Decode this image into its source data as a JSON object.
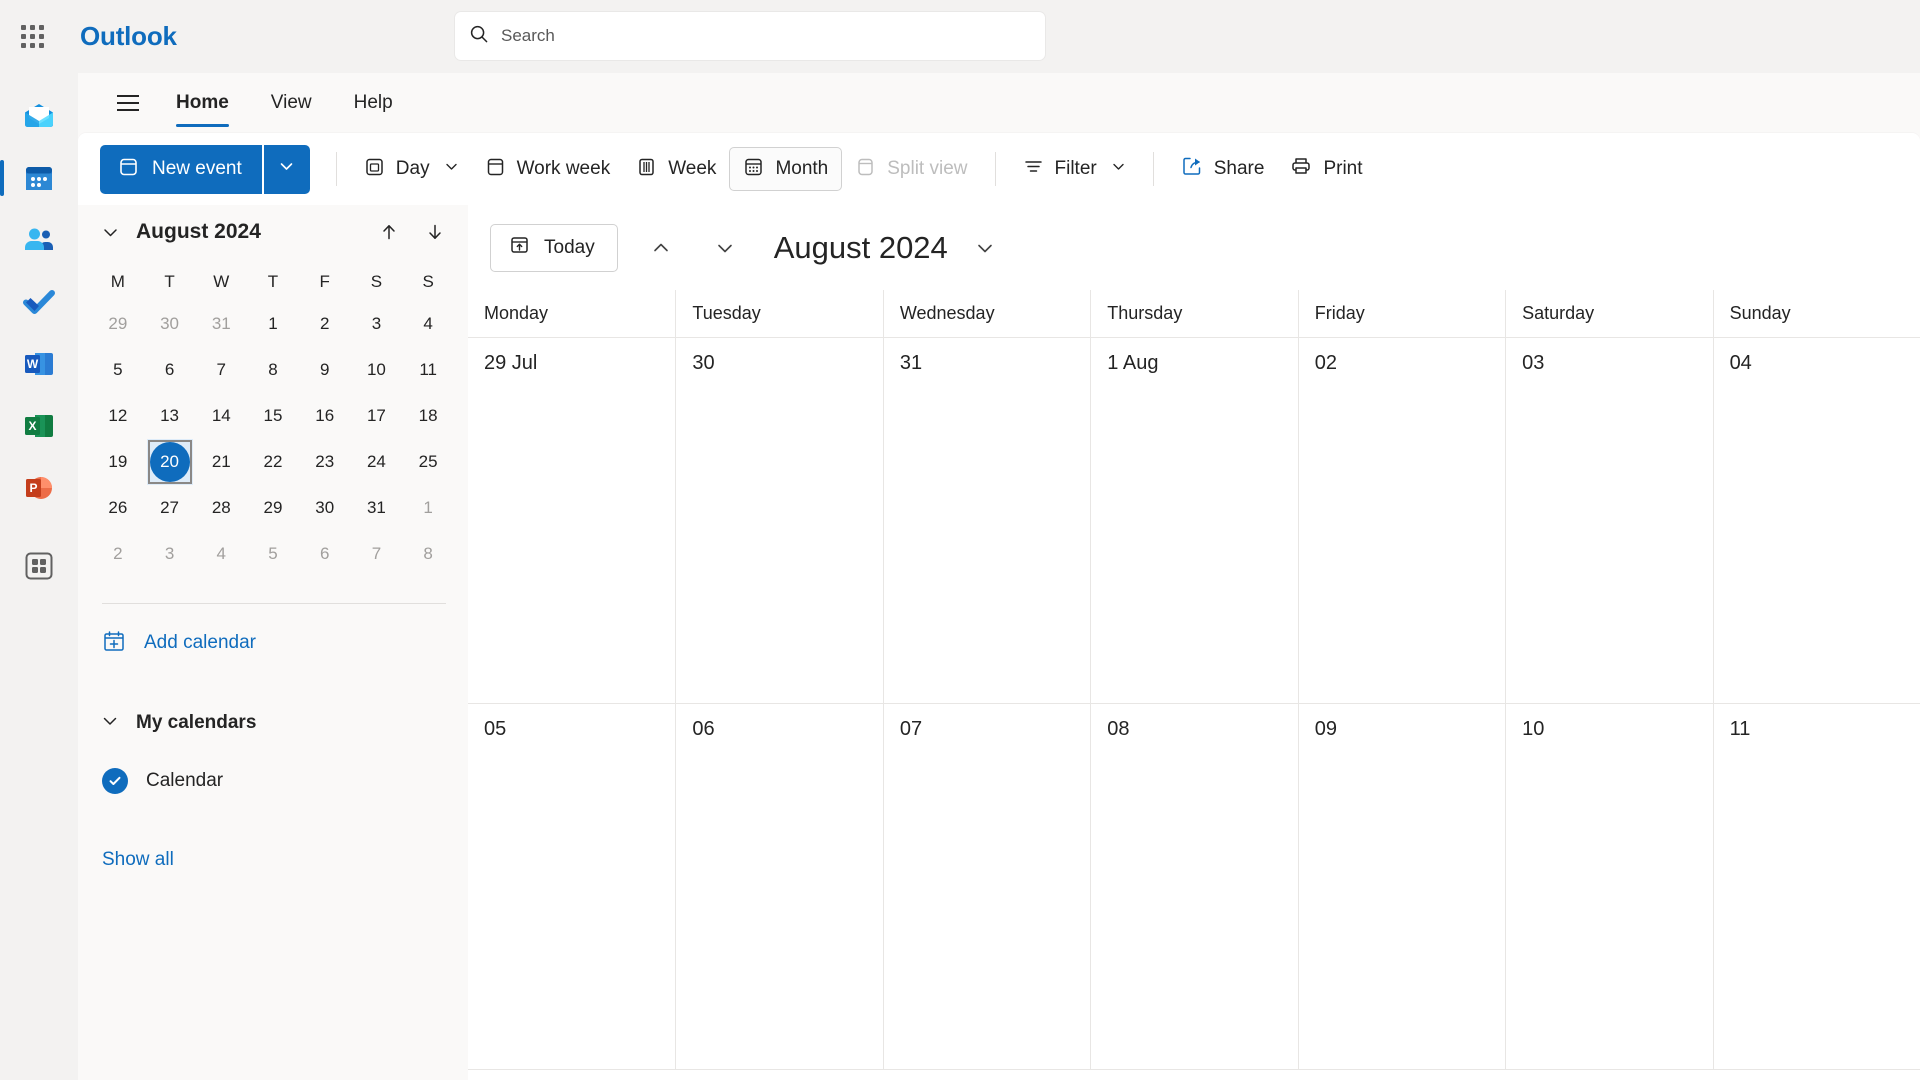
{
  "topbar": {
    "waffle_icon": "app-launcher-icon",
    "brand": "Outlook",
    "search": {
      "placeholder": "Search",
      "value": "",
      "icon": "search-icon"
    }
  },
  "rail": {
    "items": [
      {
        "name": "mail",
        "icon": "mail-icon",
        "active": false
      },
      {
        "name": "calendar",
        "icon": "calendar-icon",
        "active": true
      },
      {
        "name": "people",
        "icon": "people-icon",
        "active": false
      },
      {
        "name": "todo",
        "icon": "checkmark-icon",
        "active": false
      },
      {
        "name": "word",
        "icon": "word-icon",
        "active": false
      },
      {
        "name": "excel",
        "icon": "excel-icon",
        "active": false
      },
      {
        "name": "powerpoint",
        "icon": "powerpoint-icon",
        "active": false
      },
      {
        "name": "more-apps",
        "icon": "apps-grid-icon",
        "active": false
      }
    ]
  },
  "ribbon": {
    "hamburger_icon": "hamburger-menu-icon",
    "tabs": [
      {
        "label": "Home",
        "active": true
      },
      {
        "label": "View",
        "active": false
      },
      {
        "label": "Help",
        "active": false
      }
    ]
  },
  "commandbar": {
    "new_event": {
      "label": "New event",
      "icon": "new-event-icon",
      "caret_icon": "chevron-down-icon"
    },
    "views": [
      {
        "label": "Day",
        "icon": "day-view-icon",
        "selected": false,
        "disabled": false,
        "has_caret": true
      },
      {
        "label": "Work week",
        "icon": "work-week-view-icon",
        "selected": false,
        "disabled": false,
        "has_caret": false
      },
      {
        "label": "Week",
        "icon": "week-view-icon",
        "selected": false,
        "disabled": false,
        "has_caret": false
      },
      {
        "label": "Month",
        "icon": "month-view-icon",
        "selected": true,
        "disabled": false,
        "has_caret": false
      },
      {
        "label": "Split view",
        "icon": "split-view-icon",
        "selected": false,
        "disabled": true,
        "has_caret": false
      }
    ],
    "filter": {
      "label": "Filter",
      "icon": "filter-icon",
      "caret_icon": "chevron-down-icon"
    },
    "share": {
      "label": "Share",
      "icon": "share-icon"
    },
    "print": {
      "label": "Print",
      "icon": "print-icon"
    }
  },
  "mini_calendar": {
    "collapse_icon": "chevron-down-icon",
    "title": "August 2024",
    "prev_icon": "arrow-up-icon",
    "next_icon": "arrow-down-icon",
    "day_initials": [
      "M",
      "T",
      "W",
      "T",
      "F",
      "S",
      "S"
    ],
    "weeks": [
      [
        {
          "d": "29",
          "muted": true
        },
        {
          "d": "30",
          "muted": true
        },
        {
          "d": "31",
          "muted": true
        },
        {
          "d": "1",
          "muted": false
        },
        {
          "d": "2",
          "muted": false
        },
        {
          "d": "3",
          "muted": false
        },
        {
          "d": "4",
          "muted": false
        }
      ],
      [
        {
          "d": "5",
          "muted": false
        },
        {
          "d": "6",
          "muted": false
        },
        {
          "d": "7",
          "muted": false
        },
        {
          "d": "8",
          "muted": false
        },
        {
          "d": "9",
          "muted": false
        },
        {
          "d": "10",
          "muted": false
        },
        {
          "d": "11",
          "muted": false
        }
      ],
      [
        {
          "d": "12",
          "muted": false
        },
        {
          "d": "13",
          "muted": false
        },
        {
          "d": "14",
          "muted": false
        },
        {
          "d": "15",
          "muted": false
        },
        {
          "d": "16",
          "muted": false
        },
        {
          "d": "17",
          "muted": false
        },
        {
          "d": "18",
          "muted": false
        }
      ],
      [
        {
          "d": "19",
          "muted": false
        },
        {
          "d": "20",
          "muted": false,
          "today": true,
          "focused": true
        },
        {
          "d": "21",
          "muted": false
        },
        {
          "d": "22",
          "muted": false
        },
        {
          "d": "23",
          "muted": false
        },
        {
          "d": "24",
          "muted": false
        },
        {
          "d": "25",
          "muted": false
        }
      ],
      [
        {
          "d": "26",
          "muted": false
        },
        {
          "d": "27",
          "muted": false
        },
        {
          "d": "28",
          "muted": false
        },
        {
          "d": "29",
          "muted": false
        },
        {
          "d": "30",
          "muted": false
        },
        {
          "d": "31",
          "muted": false
        },
        {
          "d": "1",
          "muted": true
        }
      ],
      [
        {
          "d": "2",
          "muted": true
        },
        {
          "d": "3",
          "muted": true
        },
        {
          "d": "4",
          "muted": true
        },
        {
          "d": "5",
          "muted": true
        },
        {
          "d": "6",
          "muted": true
        },
        {
          "d": "7",
          "muted": true
        },
        {
          "d": "8",
          "muted": true
        }
      ]
    ]
  },
  "sidebar": {
    "add_calendar": {
      "label": "Add calendar",
      "icon": "add-calendar-icon"
    },
    "my_calendars": {
      "label": "My calendars",
      "chevron_icon": "chevron-down-icon"
    },
    "calendars": [
      {
        "name": "Calendar",
        "checked": true,
        "check_icon": "checkmark-circle-icon"
      }
    ],
    "show_all": {
      "label": "Show all"
    }
  },
  "calendar_view": {
    "today_button": {
      "label": "Today",
      "icon": "today-icon"
    },
    "prev_icon": "chevron-up-icon",
    "next_icon": "chevron-down-icon",
    "period_label": "August 2024",
    "period_caret_icon": "chevron-down-icon",
    "day_headers": [
      "Monday",
      "Tuesday",
      "Wednesday",
      "Thursday",
      "Friday",
      "Saturday",
      "Sunday"
    ],
    "weeks": [
      [
        "29 Jul",
        "30",
        "31",
        "1 Aug",
        "02",
        "03",
        "04"
      ],
      [
        "05",
        "06",
        "07",
        "08",
        "09",
        "10",
        "11"
      ]
    ]
  },
  "colors": {
    "accent": "#0f6cbd",
    "chrome": "#f3f2f1",
    "pane": "#faf9f8",
    "grid_line": "#e8e6e4",
    "text": "#242424",
    "muted_text": "#a19f9d"
  }
}
